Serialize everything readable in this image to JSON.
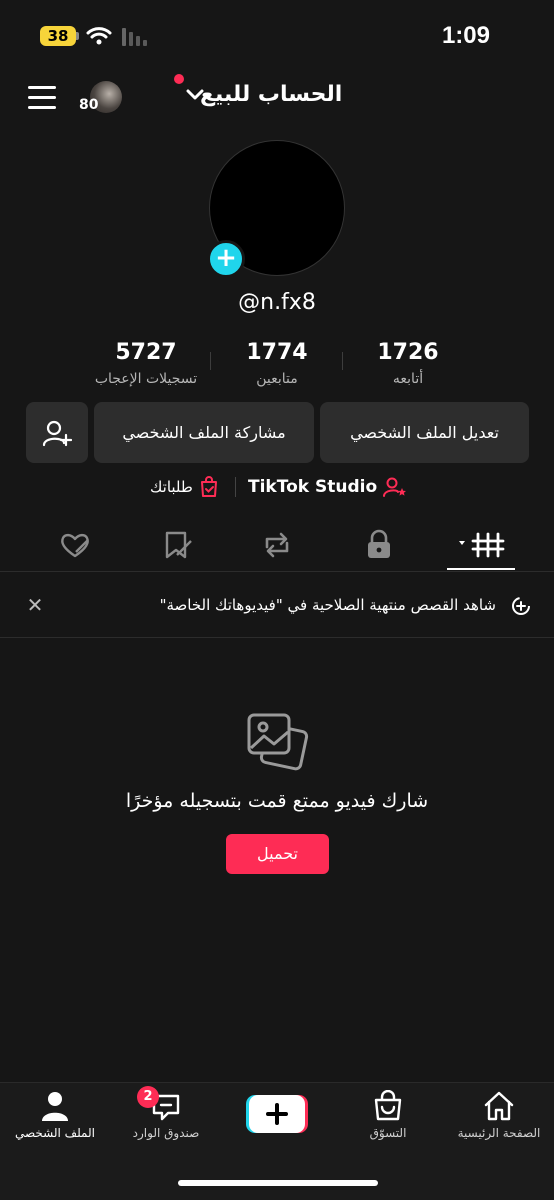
{
  "status_bar": {
    "battery": "38",
    "time": "1:09"
  },
  "header": {
    "title": "الحساب للبيع",
    "avatar_count": "80"
  },
  "profile": {
    "username": "@n.fx8"
  },
  "stats": [
    {
      "value": "5727",
      "label": "تسجيلات الإعجاب"
    },
    {
      "value": "1774",
      "label": "متابعين"
    },
    {
      "value": "1726",
      "label": "أتابعه"
    }
  ],
  "buttons": {
    "edit": "تعديل الملف الشخصي",
    "share": "مشاركة الملف الشخصي"
  },
  "links": {
    "studio": "TikTok Studio",
    "orders": "طلباتك"
  },
  "banner": {
    "text": "شاهد القصص منتهية الصلاحية في \"فيديوهاتك الخاصة\""
  },
  "empty": {
    "message": "شارك فيديو ممتع قمت بتسجيله مؤخرًا",
    "upload": "تحميل"
  },
  "bottom_nav": {
    "home": "الصفحة الرئيسية",
    "shop": "التسوّق",
    "inbox": "صندوق الوارد",
    "inbox_badge": "2",
    "profile": "الملف الشخصي"
  },
  "colors": {
    "accent": "#fe2c55",
    "cyan": "#20d5ec",
    "background": "#161616"
  }
}
